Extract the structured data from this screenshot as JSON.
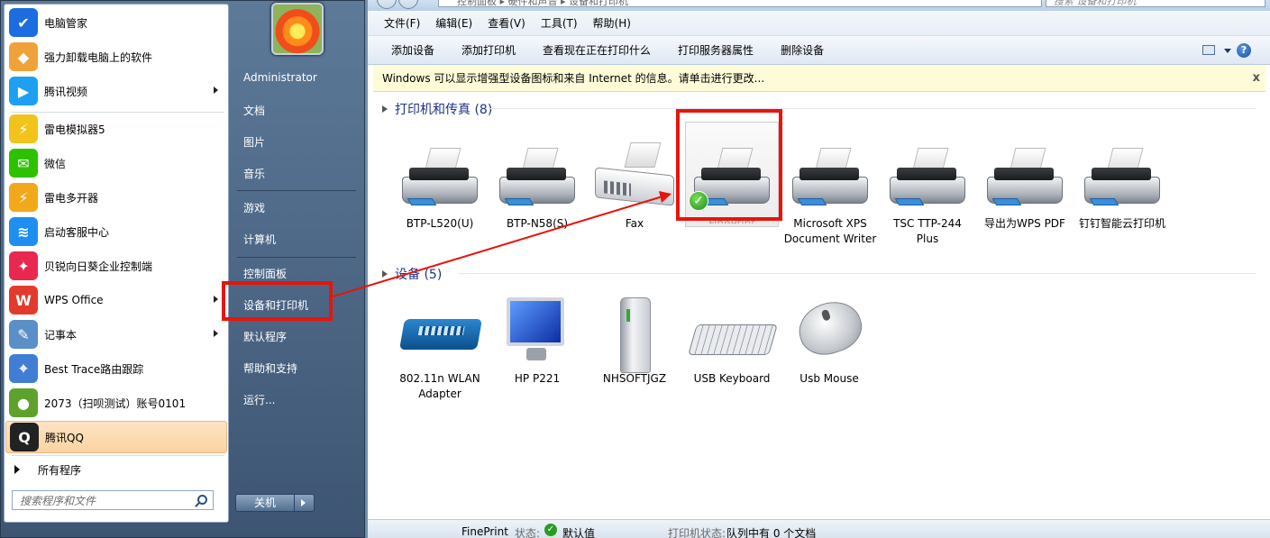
{
  "start_menu": {
    "programs": [
      {
        "label": "电脑管家",
        "icon": "shield-icon",
        "color": "#1d6ce0",
        "submenu": false
      },
      {
        "label": "强力卸载电脑上的软件",
        "icon": "uninstall-icon",
        "color": "#f0a23a",
        "submenu": false
      },
      {
        "label": "腾讯视频",
        "icon": "play-icon",
        "color": "#1ea0f2",
        "submenu": true
      },
      {
        "label": "雷电模拟器5",
        "icon": "emulator-icon",
        "color": "#f2c41b",
        "submenu": false
      },
      {
        "label": "微信",
        "icon": "wechat-icon",
        "color": "#2dc100",
        "submenu": false
      },
      {
        "label": "雷电多开器",
        "icon": "multi-instance-icon",
        "color": "#f2a81b",
        "submenu": false
      },
      {
        "label": "启动客服中心",
        "icon": "wifi-icon",
        "color": "#1f8ef1",
        "submenu": false
      },
      {
        "label": "贝锐向日葵企业控制端",
        "icon": "sunflower-icon",
        "color": "#e8284f",
        "submenu": false
      },
      {
        "label": "WPS Office",
        "icon": "wps-icon",
        "color": "#e23b2e",
        "submenu": true
      },
      {
        "label": "记事本",
        "icon": "notepad-icon",
        "color": "#5a8fc7",
        "submenu": true
      },
      {
        "label": "Best Trace路由跟踪",
        "icon": "map-icon",
        "color": "#3f7ed3",
        "submenu": false
      },
      {
        "label": "2073（扫呗测试）账号0101",
        "icon": "apple-icon",
        "color": "#5ea12c",
        "submenu": false
      },
      {
        "label": "腾讯QQ",
        "icon": "qq-penguin-icon",
        "color": "#222222",
        "submenu": false
      }
    ],
    "all_programs": "所有程序",
    "search_placeholder": "搜索程序和文件",
    "user": "Administrator",
    "right_links": [
      "文档",
      "图片",
      "音乐",
      "游戏",
      "计算机",
      "控制面板",
      "设备和打印机",
      "默认程序",
      "帮助和支持",
      "运行..."
    ],
    "shutdown": "关机"
  },
  "explorer": {
    "address": "控制面板 ▸ 硬件和声音 ▸ 设备和打印机",
    "search_placeholder": "搜索 设备和打印机",
    "menus": [
      "文件(F)",
      "编辑(E)",
      "查看(V)",
      "工具(T)",
      "帮助(H)"
    ],
    "commands": [
      "添加设备",
      "添加打印机",
      "查看现在正在打印什么",
      "打印服务器属性",
      "删除设备"
    ],
    "infobar": "Windows 可以显示增强型设备图标和来自 Internet 的信息。请单击进行更改...",
    "infobar_close": "x",
    "groups": [
      {
        "title": "打印机和传真 (8)",
        "items": [
          {
            "name": "BTP-L520(U)",
            "icon": "printer-icon"
          },
          {
            "name": "BTP-N58(S)",
            "icon": "printer-icon"
          },
          {
            "name": "Fax",
            "icon": "fax-icon"
          },
          {
            "name": "FinePrint",
            "icon": "default-printer-icon"
          },
          {
            "name": "Microsoft XPS Document Writer",
            "icon": "printer-icon"
          },
          {
            "name": "TSC TTP-244 Plus",
            "icon": "printer-icon"
          },
          {
            "name": "导出为WPS PDF",
            "icon": "printer-icon"
          },
          {
            "name": "钉钉智能云打印机",
            "icon": "printer-icon"
          }
        ]
      },
      {
        "title": "设备 (5)",
        "items": [
          {
            "name": "802.11n WLAN Adapter",
            "icon": "router-icon"
          },
          {
            "name": "HP P221",
            "icon": "monitor-icon"
          },
          {
            "name": "NHSOFTJGZ",
            "icon": "computer-tower-icon"
          },
          {
            "name": "USB Keyboard",
            "icon": "keyboard-icon"
          },
          {
            "name": "Usb Mouse",
            "icon": "mouse-icon"
          }
        ]
      }
    ],
    "status": {
      "name": "FinePrint",
      "state_label": "状态:",
      "state_value": "默认值",
      "printer_state": "打印机状态:",
      "queue": "队列中有 0 个文档"
    }
  },
  "colors": {
    "highlight_box": "#e8140c",
    "group_title": "#1e3287",
    "infobar_bg": "#fefbd8"
  }
}
